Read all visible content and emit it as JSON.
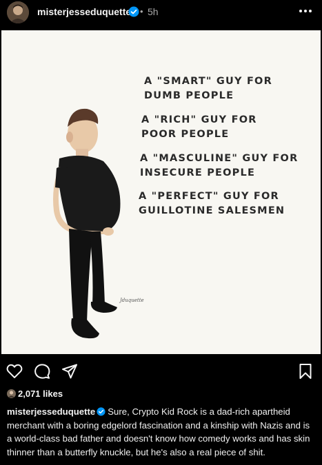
{
  "post": {
    "username": "misterjesseduquette",
    "time_sep": "•",
    "time": "5h",
    "more_icon": "more-horizontal-icon",
    "verified_icon": "verified-badge-icon"
  },
  "image": {
    "lines": [
      "A \"SMART\" GUY FOR",
      "DUMB PEOPLE",
      "A \"RICH\" GUY FOR",
      "POOR PEOPLE",
      "A \"MASCULINE\" GUY FOR",
      "INSECURE PEOPLE",
      "A \"PERFECT\" GUY FOR",
      "GUILLOTINE SALESMEN"
    ],
    "signature": "Jduquette"
  },
  "actions": {
    "icons": [
      "heart-icon",
      "comment-icon",
      "share-icon",
      "bookmark-icon"
    ]
  },
  "likes": {
    "count_text": "2,071 likes"
  },
  "caption": {
    "username": "misterjesseduquette",
    "text": "Sure, Crypto Kid Rock is a dad-rich apartheid merchant with a boring edgelord fascination and a kinship with Nazis and is a world-class bad father and doesn't know how comedy works and has skin thinner than a butterfly knuckle, but he's also a real piece of shit."
  },
  "colors": {
    "background": "#000000",
    "image_bg": "#f8f7f2",
    "verified": "#0095f6",
    "muted": "#a8a8a8"
  }
}
